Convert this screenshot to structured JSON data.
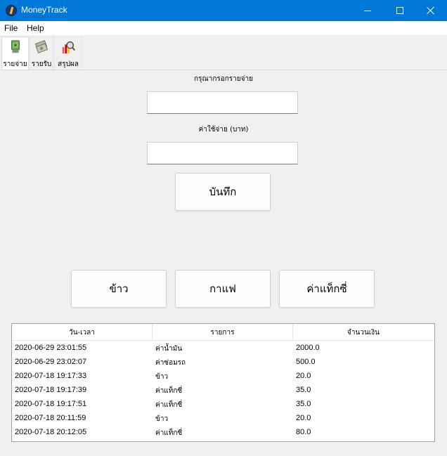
{
  "window": {
    "title": "MoneyTrack"
  },
  "menu": {
    "file": "File",
    "help": "Help"
  },
  "tabs": [
    {
      "label": "รายจ่าย",
      "icon": "money-out-icon",
      "active": true
    },
    {
      "label": "รายรับ",
      "icon": "money-in-icon",
      "active": false
    },
    {
      "label": "สรุปผล",
      "icon": "summary-search-icon",
      "active": false
    }
  ],
  "form": {
    "item_label": "กรุณากรอกรายจ่าย",
    "item_value": "",
    "amount_label": "ค่าใช้จ่าย (บาท)",
    "amount_value": "",
    "save_label": "บันทึก"
  },
  "quick_buttons": [
    "ข้าว",
    "กาแฟ",
    "ค่าแท็กซี่"
  ],
  "table": {
    "headers": [
      "วัน-เวลา",
      "รายการ",
      "จำนวนเงิน"
    ],
    "rows": [
      [
        "2020-06-29 23:01:55",
        "ค่าน้ำมัน",
        "2000.0"
      ],
      [
        "2020-06-29 23:02:07",
        "ค่าซ่อมรถ",
        "500.0"
      ],
      [
        "2020-07-18 19:17:33",
        "ข้าว",
        "20.0"
      ],
      [
        "2020-07-18 19:17:39",
        "ค่าแท็กซี่",
        "35.0"
      ],
      [
        "2020-07-18 19:17:51",
        "ค่าแท็กซี่",
        "35.0"
      ],
      [
        "2020-07-18 20:11:59",
        "ข้าว",
        "20.0"
      ],
      [
        "2020-07-18 20:12:05",
        "ค่าแท็กซี่",
        "80.0"
      ]
    ]
  }
}
